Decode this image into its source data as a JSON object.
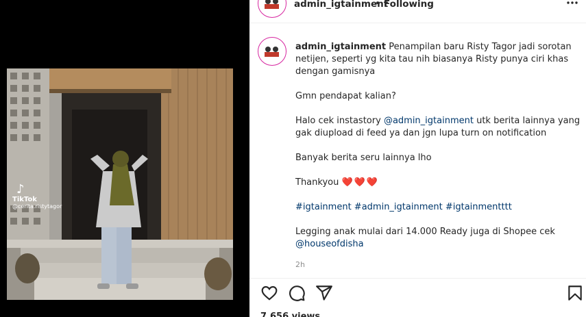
{
  "header": {
    "username": "admin_igtainment",
    "separator": "•",
    "follow_status": "Following"
  },
  "media": {
    "watermark_brand": "TikTok",
    "watermark_handle": "@cerita.ristytagor"
  },
  "caption": {
    "username": "admin_igtainment",
    "intro": "Penampilan baru Risty Tagor jadi sorotan netijen, seperti yg kita tau nih biasanya Risty punya ciri khas dengan gamisnya",
    "question": "Gmn pendapat kalian?",
    "p3_before": "Halo cek instastory ",
    "p3_mention": "@admin_igtainment",
    "p3_after": " utk berita lainnya yang gak diupload di feed ya dan jgn lupa turn on notification",
    "more_news": "Banyak berita seru lainnya lho",
    "thanks": "Thankyou ",
    "hearts": "❤️❤️❤️",
    "hashtags": "#igtainment #admin_igtainment #igtainmentttt",
    "promo": "Legging anak mulai dari 14.000 Ready juga di Shopee cek ",
    "promo_mention": "@houseofdisha"
  },
  "timestamp": "2h",
  "views": "7,656 views",
  "icons": {
    "more": "more-options-icon",
    "like": "heart-icon",
    "comment": "comment-icon",
    "share": "share-icon",
    "save": "bookmark-icon"
  },
  "colors": {
    "link": "#00376b",
    "text": "#262626",
    "muted": "#8e8e8e",
    "heart": "#ed4956",
    "avatar_ring": "#d6249f"
  }
}
